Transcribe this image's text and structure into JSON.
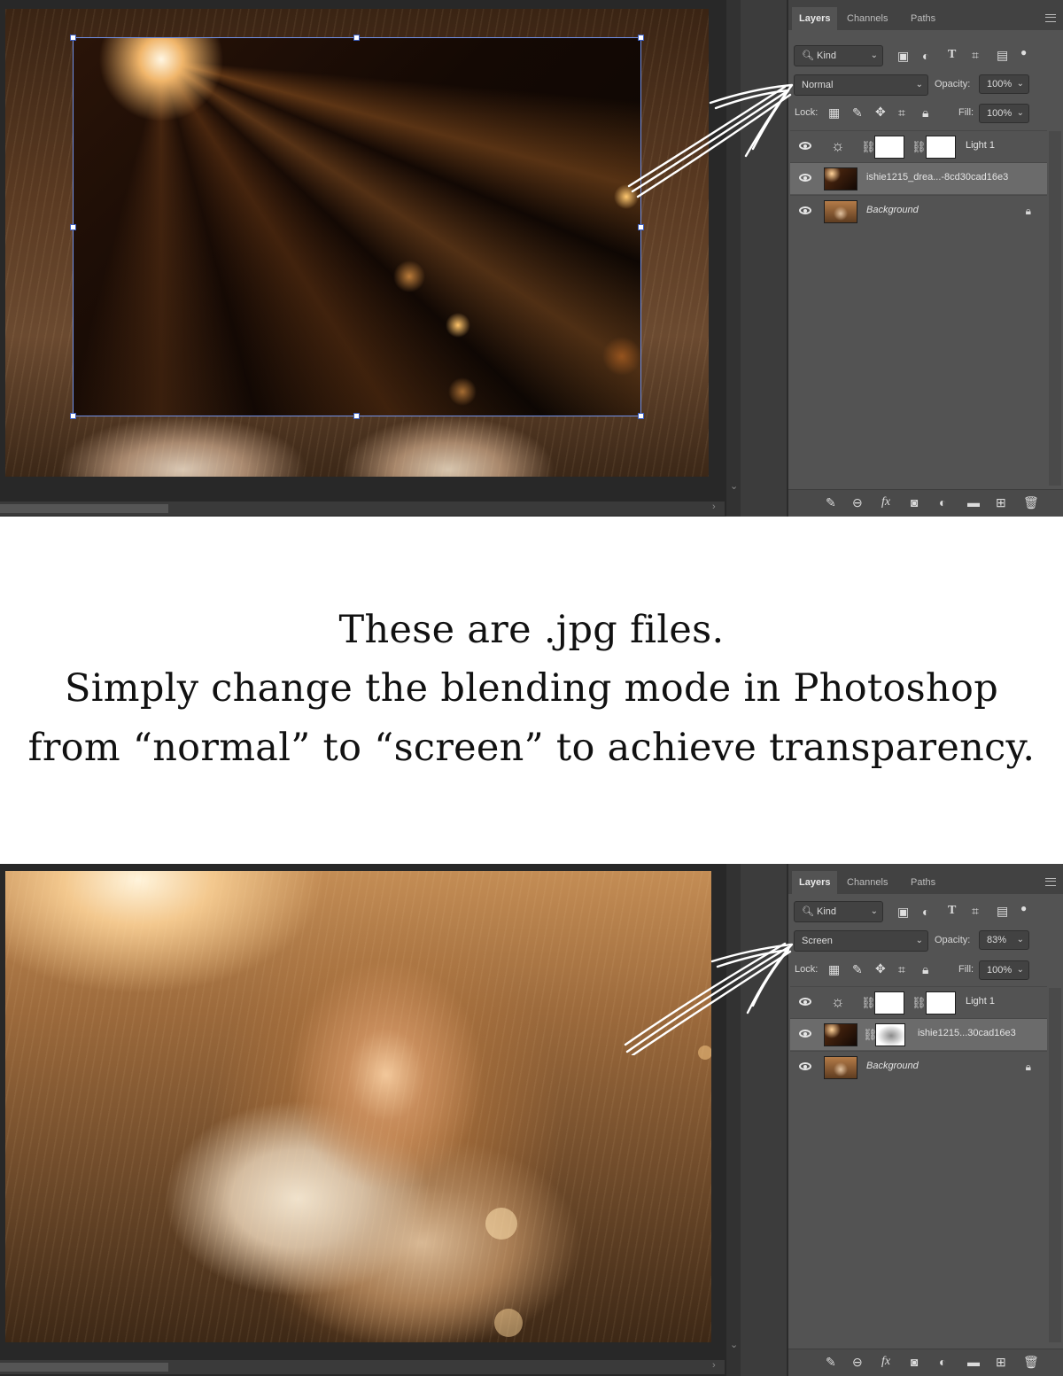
{
  "caption": {
    "line1": "These are .jpg files.",
    "line2": "Simply change the blending mode in Photoshop",
    "line3": "from “normal” to “screen” to achieve transparency."
  },
  "panels": [
    {
      "tabs": [
        "Layers",
        "Channels",
        "Paths"
      ],
      "kind_label": "Kind",
      "blend_mode": "Normal",
      "opacity_label": "Opacity:",
      "opacity": "100%",
      "lock_label": "Lock:",
      "fill_label": "Fill:",
      "fill": "100%",
      "layers": [
        {
          "name": "Light 1"
        },
        {
          "name": "ishie1215_drea...-8cd30cad16e3"
        },
        {
          "name": "Background"
        }
      ]
    },
    {
      "tabs": [
        "Layers",
        "Channels",
        "Paths"
      ],
      "kind_label": "Kind",
      "blend_mode": "Screen",
      "opacity_label": "Opacity:",
      "opacity": "83%",
      "lock_label": "Lock:",
      "fill_label": "Fill:",
      "fill": "100%",
      "layers": [
        {
          "name": "Light 1"
        },
        {
          "name": "ishie1215...30cad16e3"
        },
        {
          "name": "Background"
        }
      ]
    }
  ],
  "icons": {
    "search": "search-icon",
    "eye": "eye-icon",
    "lock": "lock-icon",
    "link": "link-icon",
    "brightness": "brightness-icon"
  },
  "colors": {
    "panel_bg": "#535353",
    "workspace_bg": "#282828",
    "selection_border": "#6f8fe6"
  }
}
